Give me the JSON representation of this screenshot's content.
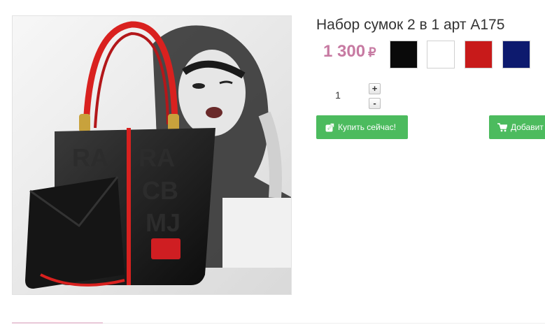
{
  "product": {
    "title": "Набор сумок 2 в 1 арт A175",
    "price": "1 300",
    "currency": "₽",
    "image_icon": "handbag-photo"
  },
  "colors": {
    "swatches": [
      "#0a0a0a",
      "#ffffff",
      "#c81a1a",
      "#0d1a6e"
    ],
    "buttons": "#4cbb5e",
    "price": "#c77aa2"
  },
  "quantity": {
    "value": "1",
    "plus_label": "+",
    "minus_label": "-"
  },
  "actions": {
    "buy_now_label": "Купить сейчас!",
    "buy_now_icon": "external-link-icon",
    "add_label": "Добавит",
    "add_icon": "cart-icon"
  }
}
